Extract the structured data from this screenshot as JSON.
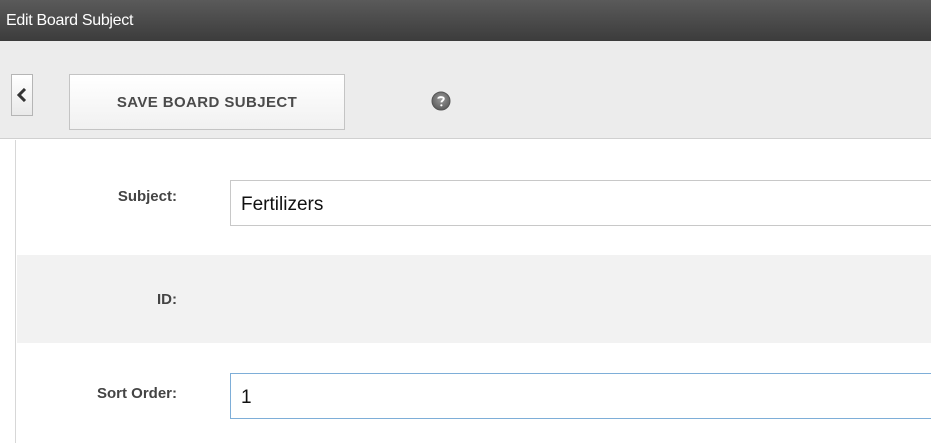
{
  "window": {
    "title": "Edit Board Subject"
  },
  "toolbar": {
    "back_icon": "chevron-left-icon",
    "save_label": "SAVE BOARD SUBJECT",
    "help_icon": "question-circle-icon"
  },
  "form": {
    "subject": {
      "label": "Subject:",
      "value": "Fertilizers"
    },
    "id": {
      "label": "ID:",
      "value": ""
    },
    "sort_order": {
      "label": "Sort Order:",
      "value": "1"
    }
  },
  "colors": {
    "title_bar": "#4a4a4a",
    "toolbar_bg": "#ececec",
    "alt_row_bg": "#f2f2f2",
    "focus_border": "#7eaed8"
  }
}
